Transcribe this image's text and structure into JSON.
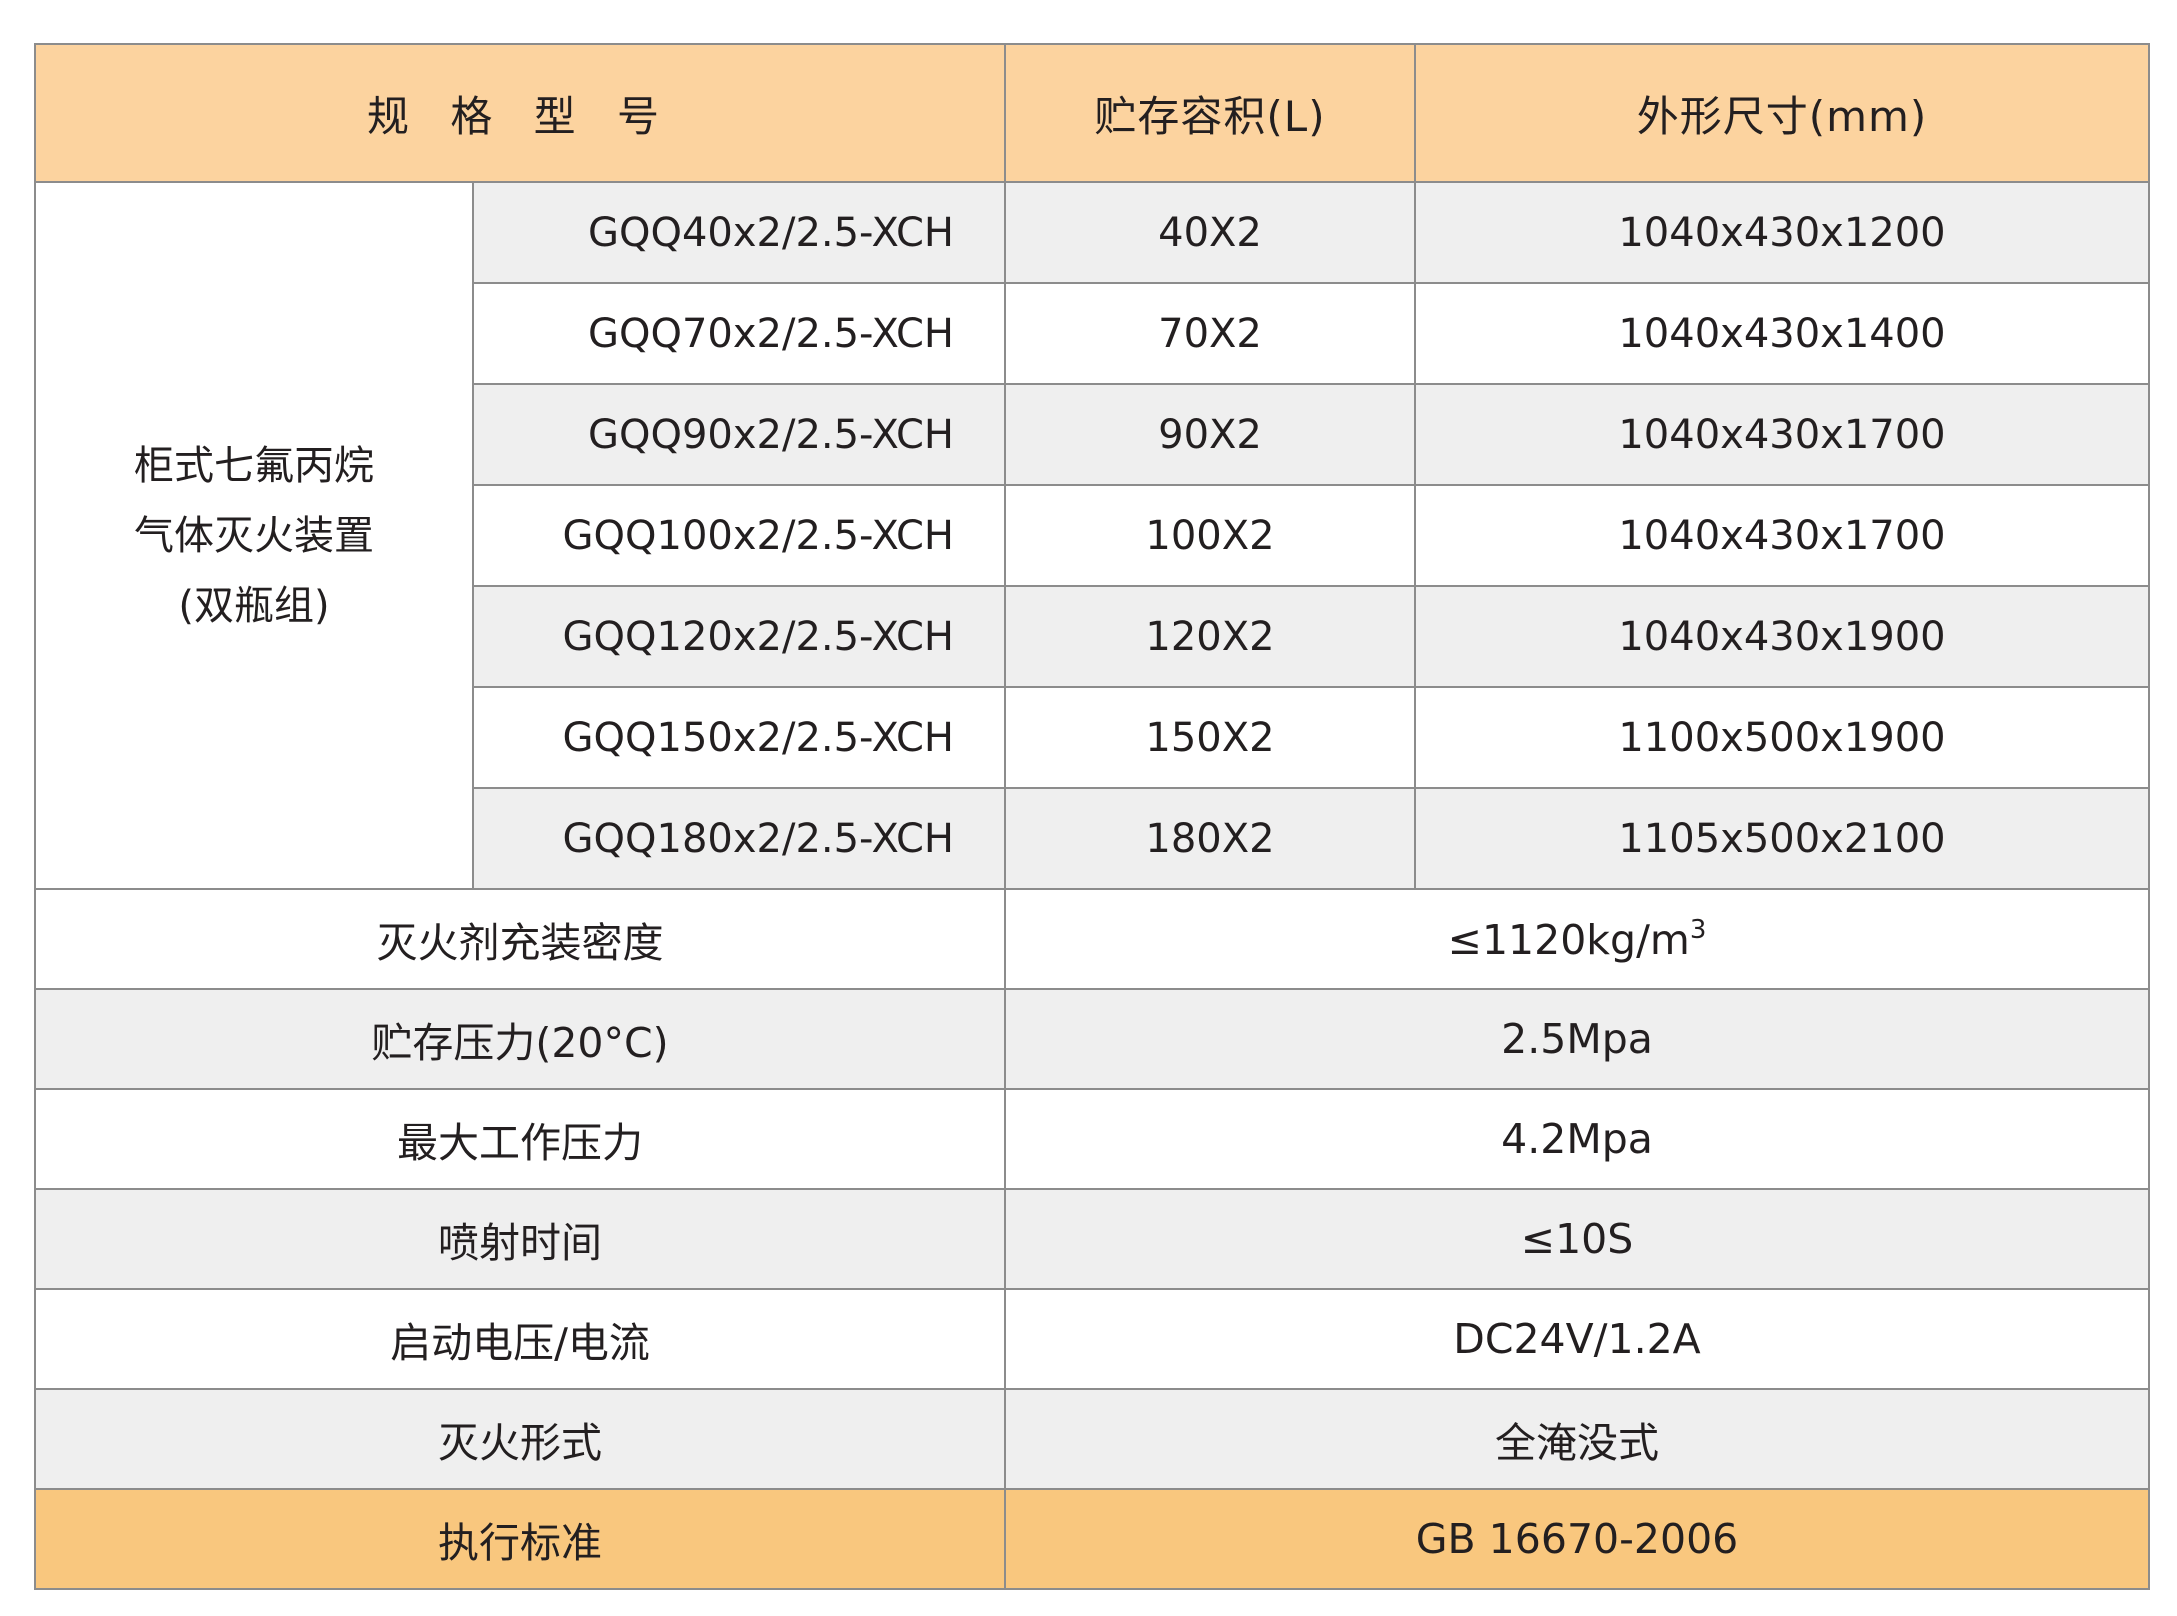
{
  "header": {
    "model": "规 格 型 号",
    "capacity": "贮存容积(L)",
    "dimensions": "外形尺寸(mm)"
  },
  "group": {
    "line1": "柜式七氟丙烷",
    "line2": "气体灭火装置",
    "line3": "(双瓶组)"
  },
  "models": [
    {
      "model": "GQQ40x2/2.5-XCH",
      "capacity": "40X2",
      "dimensions": "1040x430x1200"
    },
    {
      "model": "GQQ70x2/2.5-XCH",
      "capacity": "70X2",
      "dimensions": "1040x430x1400"
    },
    {
      "model": "GQQ90x2/2.5-XCH",
      "capacity": "90X2",
      "dimensions": "1040x430x1700"
    },
    {
      "model": "GQQ100x2/2.5-XCH",
      "capacity": "100X2",
      "dimensions": "1040x430x1700"
    },
    {
      "model": "GQQ120x2/2.5-XCH",
      "capacity": "120X2",
      "dimensions": "1040x430x1900"
    },
    {
      "model": "GQQ150x2/2.5-XCH",
      "capacity": "150X2",
      "dimensions": "1100x500x1900"
    },
    {
      "model": "GQQ180x2/2.5-XCH",
      "capacity": "180X2",
      "dimensions": "1105x500x2100"
    }
  ],
  "params": [
    {
      "label": "灭火剂充装密度",
      "value": "≤1120kg/m",
      "sup": "3"
    },
    {
      "label": "贮存压力(20°C)",
      "value": "2.5Mpa"
    },
    {
      "label": "最大工作压力",
      "value": "4.2Mpa"
    },
    {
      "label": "喷射时间",
      "value": "≤10S"
    },
    {
      "label": "启动电压/电流",
      "value": "DC24V/1.2A"
    },
    {
      "label": "灭火形式",
      "value": "全淹没式"
    },
    {
      "label": "执行标准",
      "value": "GB 16670-2006"
    }
  ],
  "colors": {
    "header_bg": "#fcd39f",
    "final_row_bg": "#f9c77e",
    "gray_row_bg": "#efefef",
    "border": "#8c8c8c"
  }
}
